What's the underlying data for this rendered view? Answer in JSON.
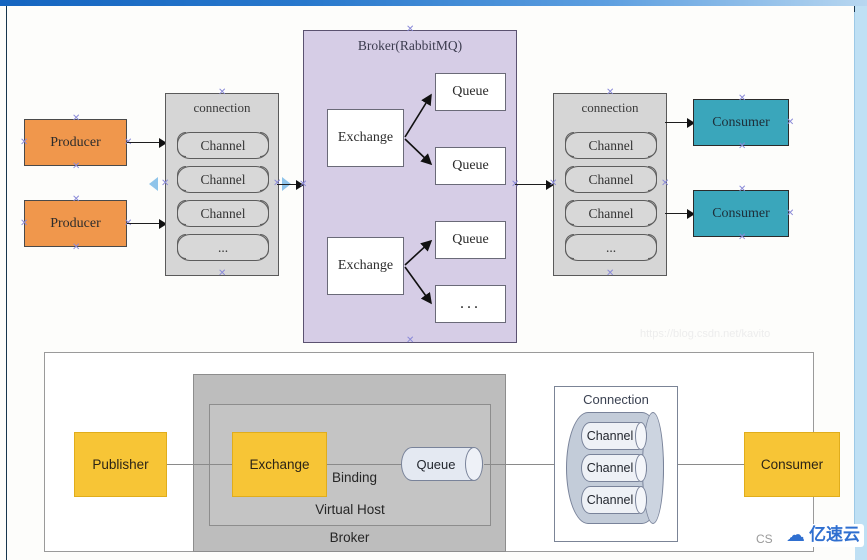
{
  "page": {
    "scrollbar_color": "#bfe0f4",
    "titlebar_color": "#1565c0"
  },
  "top_diagram": {
    "name": "RabbitMQ message flow (Visio style)",
    "producers": [
      {
        "label": "Producer"
      },
      {
        "label": "Producer"
      }
    ],
    "producer_connection": {
      "title": "connection",
      "channels": [
        "Channel",
        "Channel",
        "Channel",
        "..."
      ]
    },
    "broker": {
      "title": "Broker(RabbitMQ)",
      "exchanges": [
        {
          "label": "Exchange"
        },
        {
          "label": "Exchange"
        }
      ],
      "queues": [
        "Queue",
        "Queue",
        "Queue",
        "..."
      ]
    },
    "consumer_connection": {
      "title": "connection",
      "channels": [
        "Channel",
        "Channel",
        "Channel",
        "..."
      ]
    },
    "consumers": [
      {
        "label": "Consumer"
      },
      {
        "label": "Consumer"
      }
    ],
    "colors": {
      "producer": "#f0974c",
      "consumer": "#3aa6bb",
      "broker": "#d6cde6",
      "connection": "#d6d6d6",
      "handle": "#8a8ad8",
      "marker": "#8fc4ea"
    }
  },
  "bottom_diagram": {
    "name": "RabbitMQ broker / virtual host overview",
    "publisher": "Publisher",
    "exchange": "Exchange",
    "binding": "Binding",
    "queue": "Queue",
    "virtual_host": "Virtual Host",
    "broker": "Broker",
    "connection": "Connection",
    "channels": [
      "Channel",
      "Channel",
      "Channel"
    ],
    "consumer": "Consumer",
    "colors": {
      "node": "#f7c536",
      "broker": "#bdbdbd",
      "virtual_host": "#c4c4c4",
      "cylinder": "#c3ccd9"
    }
  },
  "watermarks": {
    "blog_url": "https://blog.csdn.net/kavito",
    "csdn": "CS",
    "logo_icon": "cloud-icon",
    "logo_text": "亿速云"
  }
}
